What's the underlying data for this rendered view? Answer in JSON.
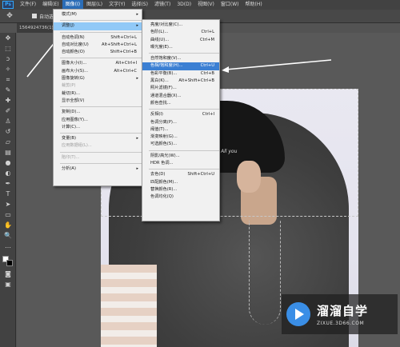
{
  "menubar": {
    "logo": "Ps",
    "items": [
      "文件(F)",
      "编辑(E)",
      "图像(I)",
      "图层(L)",
      "文字(Y)",
      "选择(S)",
      "滤镜(T)",
      "3D(D)",
      "视图(V)",
      "窗口(W)",
      "帮助(H)"
    ]
  },
  "options": {
    "auto_select_label": "自动选择："
  },
  "document": {
    "tab_title": "1564924736(1)..."
  },
  "image_menu": [
    {
      "label": "模式(M)",
      "sub": true
    },
    {
      "sep": true
    },
    {
      "label": "调整(J)",
      "sub": true,
      "state": "hl"
    },
    {
      "sep": true
    },
    {
      "label": "自动色调(N)",
      "shortcut": "Shift+Ctrl+L"
    },
    {
      "label": "自动对比度(U)",
      "shortcut": "Alt+Shift+Ctrl+L"
    },
    {
      "label": "自动颜色(O)",
      "shortcut": "Shift+Ctrl+B"
    },
    {
      "sep": true
    },
    {
      "label": "图像大小(I)...",
      "shortcut": "Alt+Ctrl+I"
    },
    {
      "label": "画布大小(S)...",
      "shortcut": "Alt+Ctrl+C"
    },
    {
      "label": "图像旋转(G)",
      "sub": true
    },
    {
      "label": "裁剪(P)",
      "disabled": true
    },
    {
      "label": "裁切(R)..."
    },
    {
      "label": "显示全部(V)"
    },
    {
      "sep": true
    },
    {
      "label": "复制(D)..."
    },
    {
      "label": "应用图像(Y)..."
    },
    {
      "label": "计算(C)..."
    },
    {
      "sep": true
    },
    {
      "label": "变量(B)",
      "sub": true
    },
    {
      "label": "应用数据组(L)...",
      "disabled": true
    },
    {
      "sep": true
    },
    {
      "label": "陷印(T)...",
      "disabled": true
    },
    {
      "sep": true
    },
    {
      "label": "分析(A)",
      "sub": true
    }
  ],
  "adjust_menu": [
    {
      "label": "亮度/对比度(C)..."
    },
    {
      "label": "色阶(L)...",
      "shortcut": "Ctrl+L"
    },
    {
      "label": "曲线(U)...",
      "shortcut": "Ctrl+M"
    },
    {
      "label": "曝光度(E)..."
    },
    {
      "sep": true
    },
    {
      "label": "自然饱和度(V)..."
    },
    {
      "label": "色相/饱和度(H)...",
      "shortcut": "Ctrl+U",
      "state": "hl-blue"
    },
    {
      "label": "色彩平衡(B)...",
      "shortcut": "Ctrl+B"
    },
    {
      "label": "黑白(K)...",
      "shortcut": "Alt+Shift+Ctrl+B"
    },
    {
      "label": "照片滤镜(F)..."
    },
    {
      "label": "通道混合器(X)..."
    },
    {
      "label": "颜色查找..."
    },
    {
      "sep": true
    },
    {
      "label": "反相(I)",
      "shortcut": "Ctrl+I"
    },
    {
      "label": "色调分离(P)..."
    },
    {
      "label": "阈值(T)..."
    },
    {
      "label": "渐变映射(G)..."
    },
    {
      "label": "可选颜色(S)..."
    },
    {
      "sep": true
    },
    {
      "label": "阴影/高光(W)..."
    },
    {
      "label": "HDR 色调..."
    },
    {
      "sep": true
    },
    {
      "label": "去色(D)",
      "shortcut": "Shift+Ctrl+U"
    },
    {
      "label": "匹配颜色(M)..."
    },
    {
      "label": "替换颜色(R)..."
    },
    {
      "label": "色调均化(Q)"
    }
  ],
  "photo": {
    "cap_text": "All you"
  },
  "watermark": {
    "title": "溜溜自学",
    "subtitle": "ZIXUE.3D66.COM"
  }
}
